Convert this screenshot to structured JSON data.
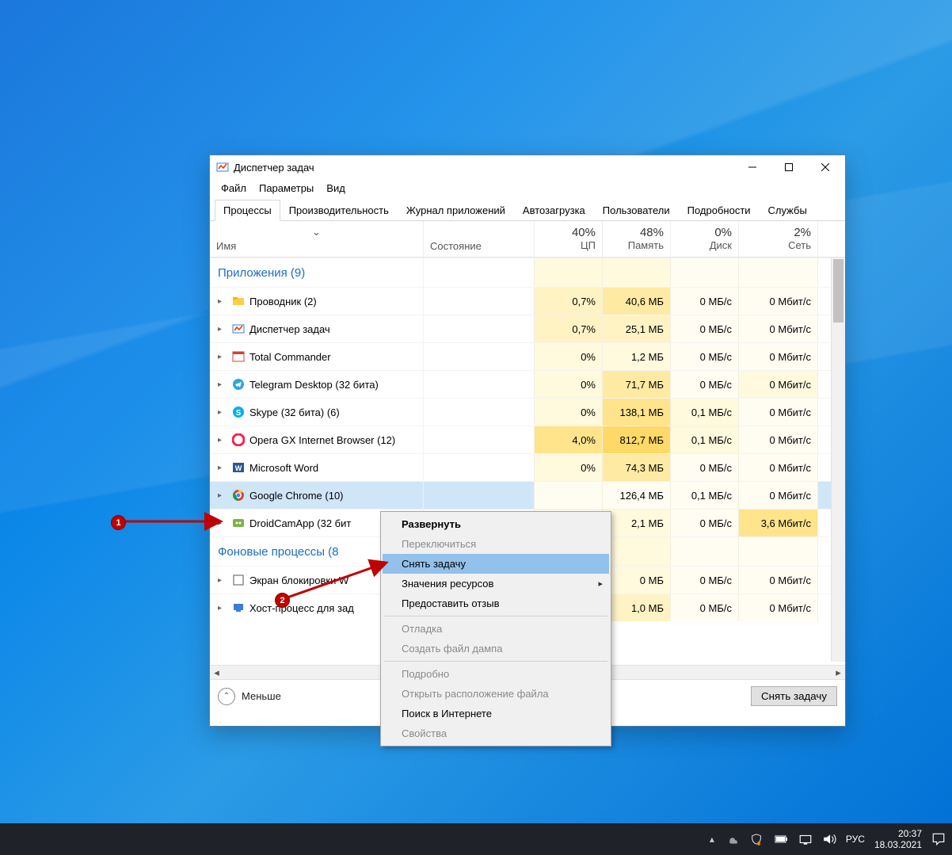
{
  "window": {
    "title": "Диспетчер задач"
  },
  "menu": [
    "Файл",
    "Параметры",
    "Вид"
  ],
  "tabs": [
    "Процессы",
    "Производительность",
    "Журнал приложений",
    "Автозагрузка",
    "Пользователи",
    "Подробности",
    "Службы"
  ],
  "columns": {
    "name": "Имя",
    "state": "Состояние",
    "cpu": {
      "pct": "40%",
      "lbl": "ЦП"
    },
    "mem": {
      "pct": "48%",
      "lbl": "Память"
    },
    "disk": {
      "pct": "0%",
      "lbl": "Диск"
    },
    "net": {
      "pct": "2%",
      "lbl": "Сеть"
    }
  },
  "groups": {
    "apps": "Приложения (9)",
    "bg": "Фоновые процессы (8"
  },
  "rows": [
    {
      "icon": "folder",
      "name": "Проводник (2)",
      "cpu": "0,7%",
      "mem": "40,6 МБ",
      "disk": "0 МБ/с",
      "net": "0 Мбит/с",
      "h": [
        "h2",
        "h3",
        "h0",
        "h0"
      ]
    },
    {
      "icon": "taskmgr",
      "name": "Диспетчер задач",
      "cpu": "0,7%",
      "mem": "25,1 МБ",
      "disk": "0 МБ/с",
      "net": "0 Мбит/с",
      "h": [
        "h2",
        "h2",
        "h0",
        "h0"
      ]
    },
    {
      "icon": "tc",
      "name": "Total Commander",
      "cpu": "0%",
      "mem": "1,2 МБ",
      "disk": "0 МБ/с",
      "net": "0 Мбит/с",
      "h": [
        "h1",
        "h1",
        "h0",
        "h0"
      ]
    },
    {
      "icon": "tg",
      "name": "Telegram Desktop (32 бита)",
      "cpu": "0%",
      "mem": "71,7 МБ",
      "disk": "0 МБ/с",
      "net": "0 Мбит/с",
      "h": [
        "h1",
        "h3",
        "h0",
        "h1"
      ]
    },
    {
      "icon": "skype",
      "name": "Skype (32 бита) (6)",
      "cpu": "0%",
      "mem": "138,1 МБ",
      "disk": "0,1 МБ/с",
      "net": "0 Мбит/с",
      "h": [
        "h1",
        "h4",
        "h1",
        "h0"
      ]
    },
    {
      "icon": "opera",
      "name": "Opera GX Internet Browser (12)",
      "cpu": "4,0%",
      "mem": "812,7 МБ",
      "disk": "0,1 МБ/с",
      "net": "0 Мбит/с",
      "h": [
        "h4",
        "h5",
        "h1",
        "h0"
      ]
    },
    {
      "icon": "word",
      "name": "Microsoft Word",
      "cpu": "0%",
      "mem": "74,3 МБ",
      "disk": "0 МБ/с",
      "net": "0 Мбит/с",
      "h": [
        "h1",
        "h3",
        "h0",
        "h0"
      ]
    },
    {
      "icon": "chrome",
      "name": "Google Chrome (10)",
      "cpu": "",
      "mem": "126,4 МБ",
      "disk": "0,1 МБ/с",
      "net": "0 Мбит/с",
      "sel": true,
      "h": [
        "h0",
        "h0",
        "h0",
        "h0"
      ]
    },
    {
      "icon": "droid",
      "name": "DroidCamApp (32 бит",
      "cpu": "",
      "mem": "2,1 МБ",
      "disk": "0 МБ/с",
      "net": "3,6 Мбит/с",
      "h": [
        "h0",
        "h1",
        "h0",
        "h4"
      ]
    }
  ],
  "bgrows": [
    {
      "icon": "lock",
      "name": "Экран блокировки W",
      "cpu": "",
      "mem": "0 МБ",
      "disk": "0 МБ/с",
      "net": "0 Мбит/с",
      "h": [
        "h0",
        "h1",
        "h0",
        "h0"
      ]
    },
    {
      "icon": "host",
      "name": "Хост-процесс для зад",
      "cpu": "",
      "mem": "1,0 МБ",
      "disk": "0 МБ/с",
      "net": "0 Мбит/с",
      "h": [
        "h0",
        "h2",
        "h0",
        "h0"
      ]
    }
  ],
  "context": [
    {
      "t": "Развернуть",
      "bold": true
    },
    {
      "t": "Переключиться",
      "d": true
    },
    {
      "t": "Снять задачу",
      "hl": true
    },
    {
      "t": "Значения ресурсов",
      "sub": true
    },
    {
      "t": "Предоставить отзыв"
    },
    {
      "sep": true
    },
    {
      "t": "Отладка",
      "d": true
    },
    {
      "t": "Создать файл дампа",
      "d": true
    },
    {
      "sep": true
    },
    {
      "t": "Подробно",
      "d": true
    },
    {
      "t": "Открыть расположение файла",
      "d": true
    },
    {
      "t": "Поиск в Интернете"
    },
    {
      "t": "Свойства",
      "d": true
    }
  ],
  "footer": {
    "less": "Меньше",
    "end": "Снять задачу"
  },
  "taskbar": {
    "lang": "РУС",
    "time": "20:37",
    "date": "18.03.2021"
  }
}
